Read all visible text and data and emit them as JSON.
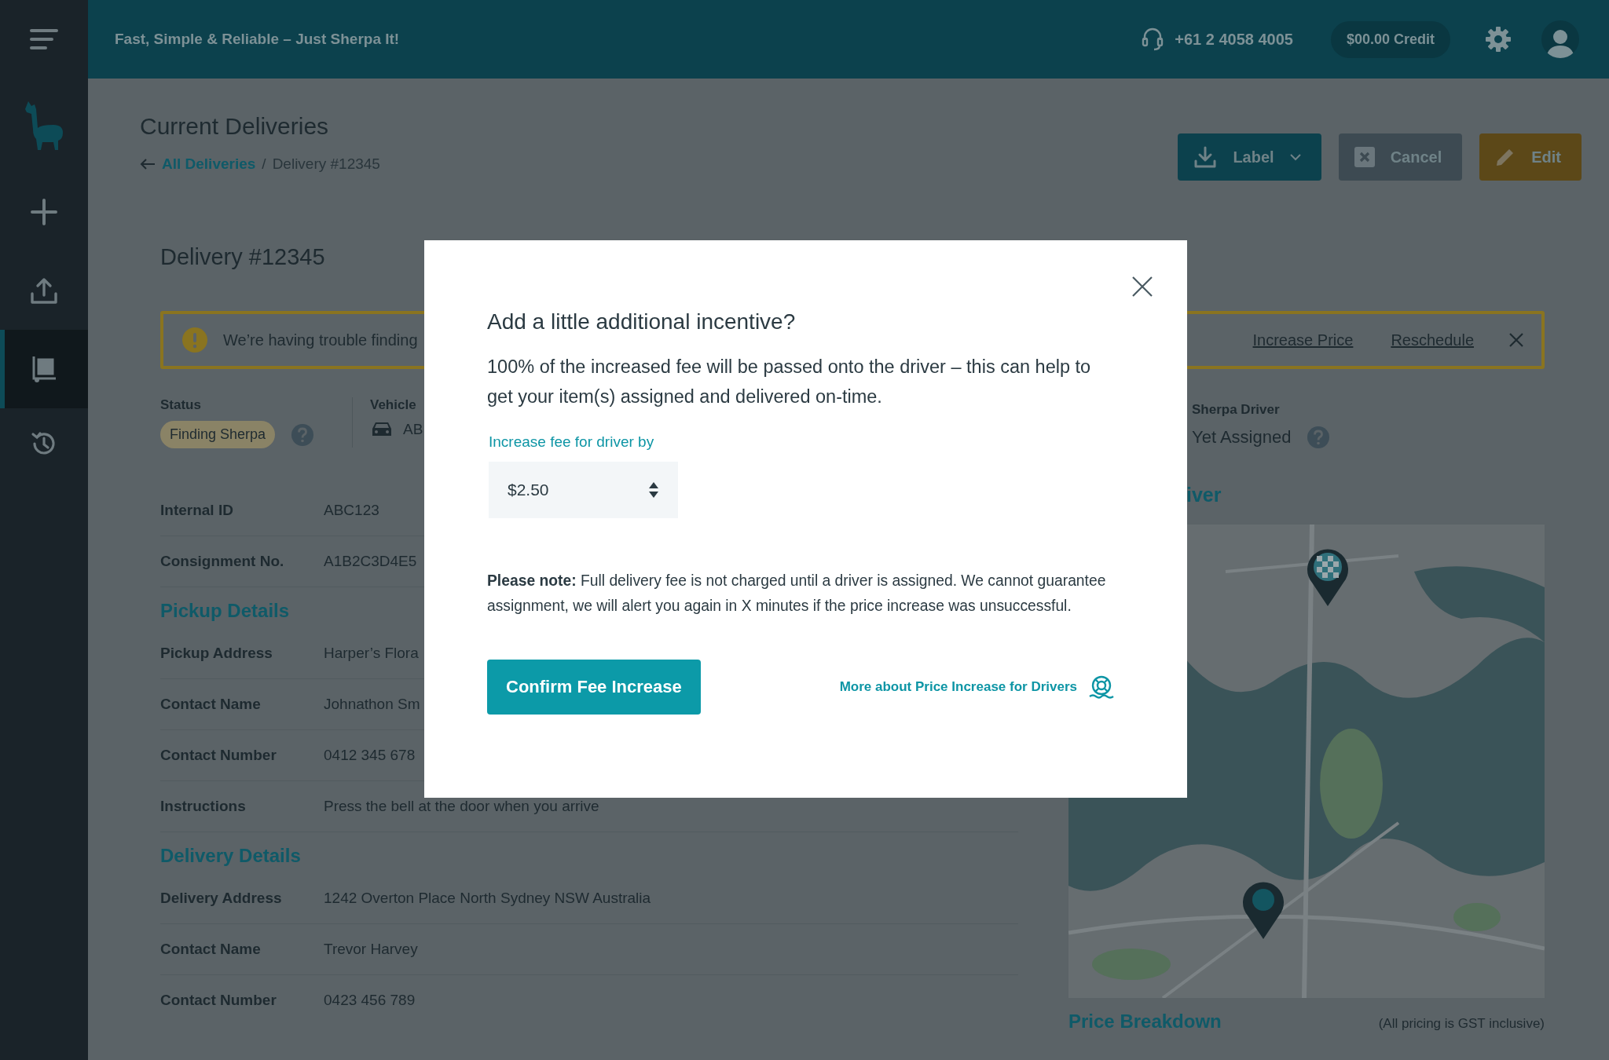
{
  "top_bar": {
    "tagline": "Fast, Simple & Reliable – Just Sherpa It!",
    "phone": "+61 2 4058 4005",
    "credit": "$00.00 Credit"
  },
  "sidebar": {
    "items": [
      {
        "kind": "menu",
        "selected": false
      },
      {
        "kind": "logo",
        "selected": false
      },
      {
        "kind": "add",
        "selected": false
      },
      {
        "kind": "upload",
        "selected": false
      },
      {
        "kind": "deliveries",
        "selected": true
      },
      {
        "kind": "history",
        "selected": false
      }
    ]
  },
  "header": {
    "title": "Current Deliveries",
    "separator": "/",
    "breadcrumb": [
      {
        "label": "All Deliveries",
        "kind": "link"
      },
      {
        "label": "Delivery #12345",
        "kind": "current"
      }
    ],
    "actions": [
      {
        "label": "Label",
        "kind": "label"
      },
      {
        "label": "Cancel",
        "kind": "cancel"
      },
      {
        "label": "Edit",
        "kind": "edit"
      }
    ]
  },
  "delivery": {
    "title": "Delivery #12345",
    "alert": {
      "message": "We’re having trouble finding",
      "links": [
        "Increase Price",
        "Reschedule"
      ]
    },
    "status": {
      "label": "Status",
      "value": "Finding Sherpa"
    },
    "vehicle": {
      "label": "Vehicle",
      "value": "AB"
    },
    "driver": {
      "label": "Sherpa Driver",
      "value": "Yet Assigned"
    },
    "rows": [
      {
        "label": "Internal ID",
        "value": "ABC123"
      },
      {
        "label": "Consignment No.",
        "value": "A1B2C3D4E5"
      }
    ],
    "sections": [
      {
        "heading": "Pickup Details",
        "rows": [
          {
            "label": "Pickup Address",
            "value": "Harper’s Flora"
          },
          {
            "label": "Contact Name",
            "value": "Johnathon Sm"
          },
          {
            "label": "Contact Number",
            "value": "0412 345 678"
          },
          {
            "label": "Instructions",
            "value": "Press the bell at the door when you arrive"
          }
        ]
      },
      {
        "heading": "Delivery Details",
        "rows": [
          {
            "label": "Delivery Address",
            "value": "1242 Overton Place North Sydney NSW Australia"
          },
          {
            "label": "Contact Name",
            "value": "Trevor Harvey"
          },
          {
            "label": "Contact Number",
            "value": "0423 456 789"
          }
        ]
      }
    ]
  },
  "map_section": {
    "heading": "iver"
  },
  "price_breakdown": {
    "heading": "Price Breakdown",
    "note": "(All pricing is GST inclusive)"
  },
  "modal": {
    "title": "Add a little additional incentive?",
    "body": "100% of the increased fee will be passed onto the driver – this can help to get your item(s) assigned and delivered on-time.",
    "field_label": "Increase fee for driver by",
    "field_value": "$2.50",
    "note": "**Please note:** Full delivery fee is not charged until a driver is assigned. We cannot guarantee assignment, we will alert you again in X minutes if the price increase was unsuccessful.",
    "confirm_button": "Confirm Fee Increase",
    "help_link": "More about Price Increase for Drivers"
  }
}
